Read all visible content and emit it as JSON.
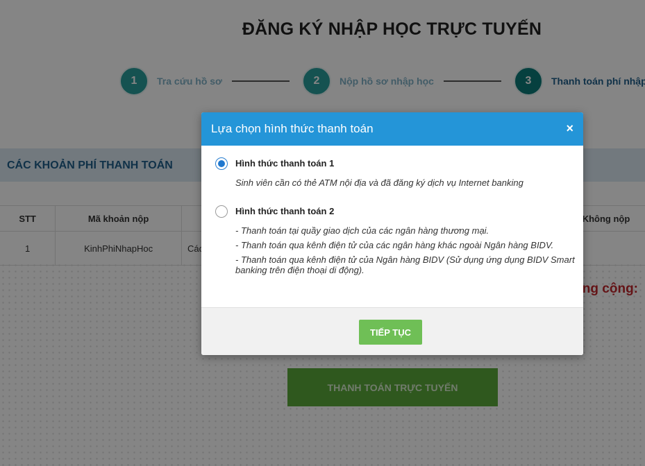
{
  "page": {
    "title": "ĐĂNG KÝ NHẬP HỌC TRỰC TUYẾN"
  },
  "steps": [
    {
      "num": "1",
      "label": "Tra cứu hồ sơ"
    },
    {
      "num": "2",
      "label": "Nộp hồ sơ nhập học"
    },
    {
      "num": "3",
      "label": "Thanh toán phí nhập"
    }
  ],
  "section": {
    "title": "CÁC KHOẢN PHÍ THANH TOÁN"
  },
  "table": {
    "headers": {
      "stt": "STT",
      "ma_khoan_nop": "Mã khoản nộp",
      "khong_nop": "Không nộp"
    },
    "rows": [
      {
        "stt": "1",
        "ma_khoan_nop": "KinhPhiNhapHoc",
        "ten": "Các"
      }
    ]
  },
  "total": {
    "label": "ng cộng:"
  },
  "pay_online": {
    "label": "THANH TOÁN TRỰC TUYẾN"
  },
  "modal": {
    "title": "Lựa chọn hình thức thanh toán",
    "close_icon": "×",
    "option1": {
      "label": "Hình thức thanh toán 1",
      "desc": "Sinh viên cần có thẻ ATM nội địa và đã đăng ký dịch vụ Internet banking",
      "selected": true
    },
    "option2": {
      "label": "Hình thức thanh toán 2",
      "desc": [
        "- Thanh toán tại quầy giao dịch của các ngân hàng thương mại.",
        "- Thanh toán qua kênh điện tử của các ngân hàng khác ngoài Ngân hàng BIDV.",
        "- Thanh toán qua kênh điện tử của Ngân hàng BIDV (Sử dụng ứng dụng BIDV Smart banking trên điện thoại di động)."
      ],
      "selected": false
    },
    "continue_label": "TIẾP TỤC"
  },
  "colors": {
    "modal_header": "#2495d8",
    "continue_button": "#6fbf56",
    "step_circle": "#2a9d9b",
    "total_text": "#c0282d"
  }
}
